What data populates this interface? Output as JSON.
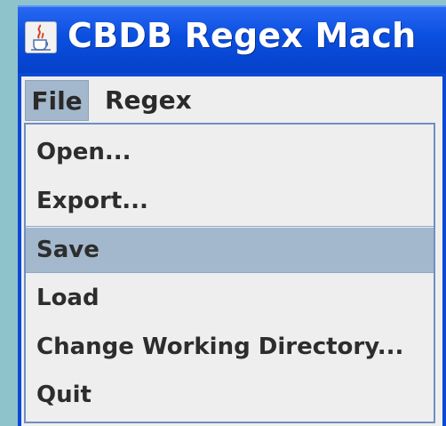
{
  "window": {
    "title": "CBDB Regex Mach",
    "icon": "java-cup-icon"
  },
  "menubar": {
    "menus": [
      {
        "label": "File",
        "active": true
      },
      {
        "label": "Regex",
        "active": false
      }
    ]
  },
  "file_menu": {
    "items": [
      {
        "label": "Open..."
      },
      {
        "label": "Export..."
      },
      {
        "label": "Save",
        "selected": true
      },
      {
        "label": "Load"
      },
      {
        "label": "Change Working Directory..."
      },
      {
        "label": "Quit"
      }
    ]
  },
  "colors": {
    "titlebar": "#0b4fe0",
    "menu_highlight": "#a3b8cc",
    "menu_background": "#eeeeee",
    "desktop": "#8fc3cb"
  }
}
